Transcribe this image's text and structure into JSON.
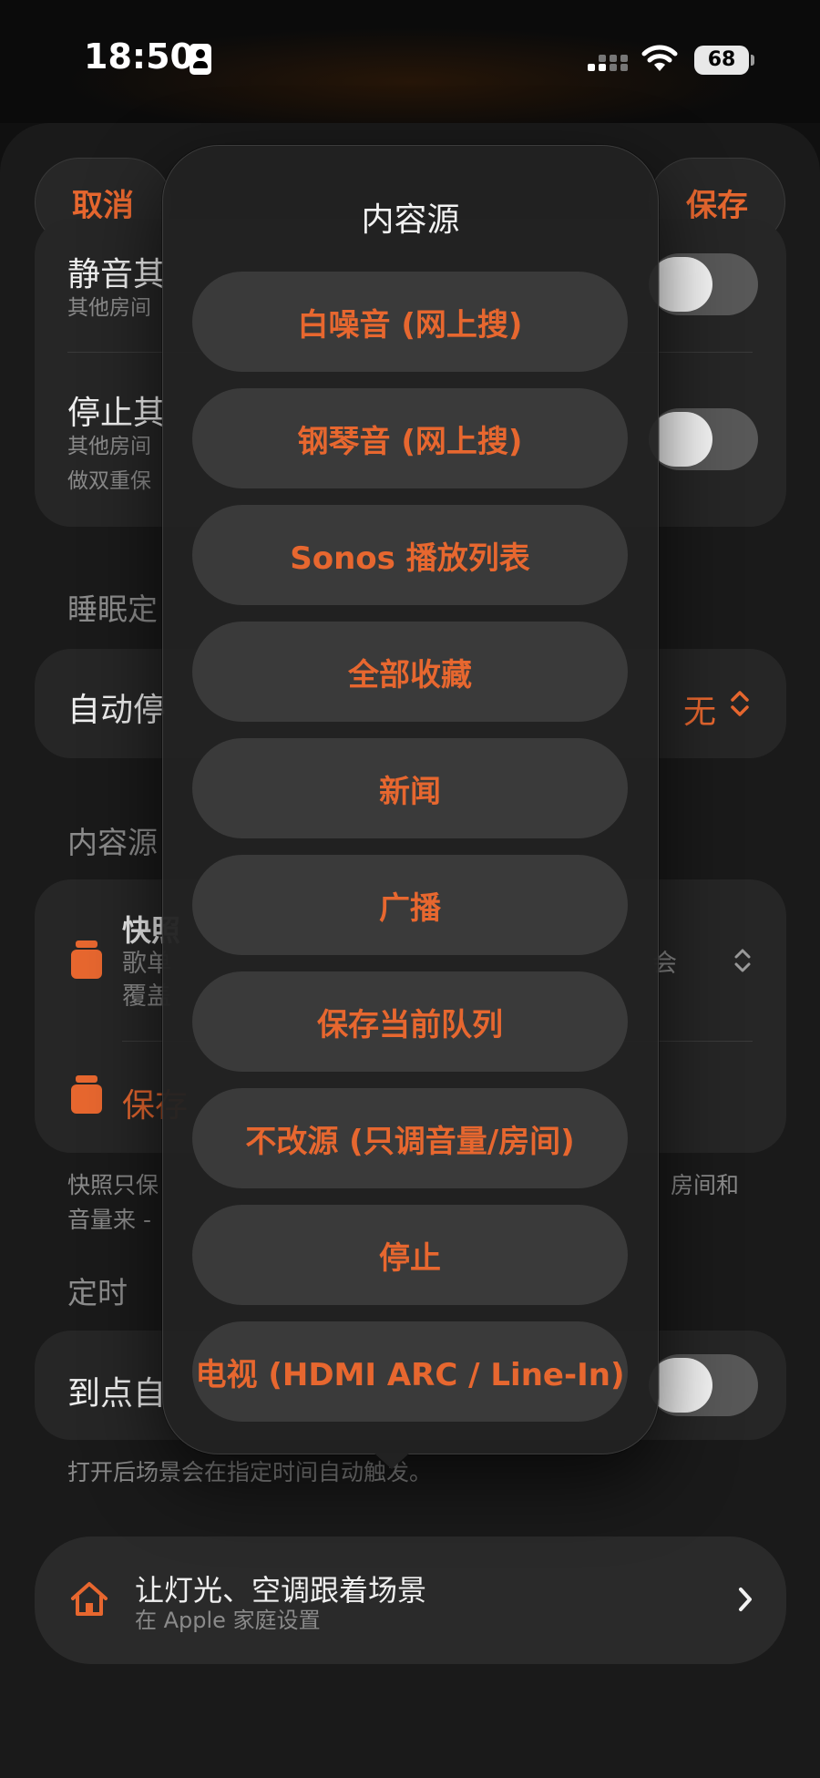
{
  "status_bar": {
    "time": "18:50",
    "battery": "68"
  },
  "header": {
    "cancel_label": "取消",
    "save_label": "保存"
  },
  "settings": {
    "mute_row": {
      "title": "静音其",
      "subtitle": "其他房间"
    },
    "stop_row": {
      "title": "停止其",
      "subtitle_line1": "其他房间",
      "subtitle_line2": "做双重保"
    },
    "sleep_section": "睡眠定",
    "auto_stop_row": {
      "title": "自动停",
      "value": "无"
    },
    "content_source_section": "内容源",
    "snapshot_row": {
      "title": "快照",
      "subtitle_line1": "歌单",
      "subtitle_line2": "覆盖",
      "trailing": "会"
    },
    "save_row": {
      "title": "保存"
    },
    "snapshot_note_line1_left": "快照只保",
    "snapshot_note_line1_right": "房间和",
    "snapshot_note_line2": "音量来 -",
    "timer_section": "定时",
    "timer_row": {
      "title": "到点自"
    },
    "timer_note": "打开后场景会在指定时间自动触发。",
    "home_card": {
      "title": "让灯光、空调跟着场景",
      "subtitle": "在 Apple 家庭设置"
    }
  },
  "menu": {
    "title": "内容源",
    "items": [
      {
        "label": "白噪音 (网上搜)"
      },
      {
        "label": "钢琴音 (网上搜)"
      },
      {
        "label": "Sonos 播放列表"
      },
      {
        "label": "全部收藏"
      },
      {
        "label": "新闻"
      },
      {
        "label": "广播"
      },
      {
        "label": "保存当前队列"
      },
      {
        "label": "不改源 (只调音量/房间)"
      },
      {
        "label": "停止"
      },
      {
        "label": "电视 (HDMI ARC / Line-In)"
      }
    ]
  },
  "colors": {
    "accent": "#e7672f",
    "background": "#1a1a1a",
    "card": "#262626"
  },
  "icons": [
    "id-card-icon",
    "cellular-icon",
    "wifi-icon",
    "battery-icon",
    "jar-icon",
    "home-icon",
    "chevron-right-icon",
    "chevron-updown-icon"
  ]
}
